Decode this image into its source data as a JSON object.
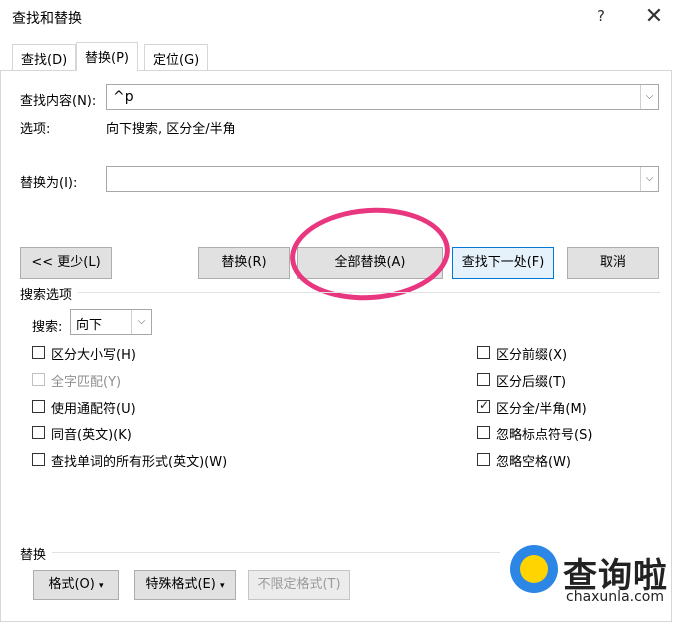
{
  "window": {
    "title": "查找和替换",
    "help": "?",
    "close": "✕"
  },
  "tabs": [
    {
      "label": "查找(D)",
      "active": false
    },
    {
      "label": "替换(P)",
      "active": true
    },
    {
      "label": "定位(G)",
      "active": false
    }
  ],
  "find": {
    "label": "查找内容(N):",
    "value": "^p",
    "options_label": "选项:",
    "options_value": "向下搜索, 区分全/半角"
  },
  "replace": {
    "label": "替换为(I):",
    "value": ""
  },
  "buttons": {
    "less": "<< 更少(L)",
    "replace": "替换(R)",
    "replace_all": "全部替换(A)",
    "find_next": "查找下一处(F)",
    "cancel": "取消"
  },
  "search_options": {
    "section_title": "搜索选项",
    "search_label": "搜索:",
    "search_value": "向下",
    "left_checks": [
      {
        "label": "区分大小写(H)",
        "checked": false,
        "disabled": false
      },
      {
        "label": "全字匹配(Y)",
        "checked": false,
        "disabled": true
      },
      {
        "label": "使用通配符(U)",
        "checked": false,
        "disabled": false
      },
      {
        "label": "同音(英文)(K)",
        "checked": false,
        "disabled": false
      },
      {
        "label": "查找单词的所有形式(英文)(W)",
        "checked": false,
        "disabled": false
      }
    ],
    "right_checks": [
      {
        "label": "区分前缀(X)",
        "checked": false
      },
      {
        "label": "区分后缀(T)",
        "checked": false
      },
      {
        "label": "区分全/半角(M)",
        "checked": true
      },
      {
        "label": "忽略标点符号(S)",
        "checked": false
      },
      {
        "label": "忽略空格(W)",
        "checked": false
      }
    ]
  },
  "replace_section": {
    "title": "替换",
    "format": "格式(O)",
    "special": "特殊格式(E)",
    "no_format": "不限定格式(T)"
  },
  "watermark": {
    "brand": "查询啦",
    "url": "chaxunla.com"
  },
  "colors": {
    "annotation_circle": "#e8367f",
    "primary_border": "#0078d7"
  }
}
